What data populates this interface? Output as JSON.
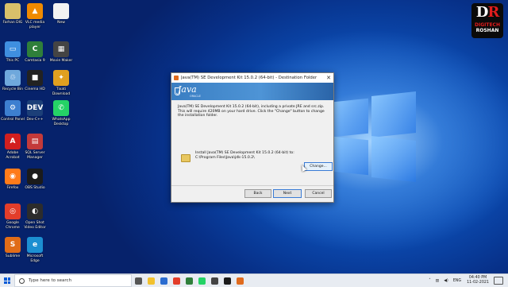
{
  "desktop_icons": [
    {
      "label": "Farhan DIG",
      "color": "#d8c06a",
      "glyph": "",
      "left": 0,
      "top": 0
    },
    {
      "label": "VLC media player",
      "color": "#f08a00",
      "glyph": "▲",
      "left": 0,
      "top": 0
    },
    {
      "label": "New",
      "color": "#f2f2f2",
      "glyph": "",
      "left": 0,
      "top": 0
    },
    {
      "label": "This PC",
      "color": "#3f8fe0",
      "glyph": "▭",
      "left": 0,
      "top": 0
    },
    {
      "label": "Camtasia 9",
      "color": "#2f7f3a",
      "glyph": "C",
      "left": 0,
      "top": 0
    },
    {
      "label": "Movie Maker",
      "color": "#444444",
      "glyph": "▦",
      "left": 0,
      "top": 0
    },
    {
      "label": "Recycle Bin",
      "color": "#6fa8dc",
      "glyph": "♲",
      "left": 0,
      "top": 0
    },
    {
      "label": "Cinema HD",
      "color": "#222222",
      "glyph": "■",
      "left": 0,
      "top": 0
    },
    {
      "label": "Tixati Download",
      "color": "#e0a020",
      "glyph": "✦",
      "left": 0,
      "top": 0
    },
    {
      "label": "Control Panel",
      "color": "#3d7fd0",
      "glyph": "⚙",
      "left": 0,
      "top": 0
    },
    {
      "label": "Dev-C++",
      "color": "#1c3f78",
      "glyph": "DEV",
      "left": 0,
      "top": 0
    },
    {
      "label": "WhatsApp Desktop",
      "color": "#25d366",
      "glyph": "✆",
      "left": 0,
      "top": 0
    },
    {
      "label": "Adobe Acrobat",
      "color": "#d21f1f",
      "glyph": "A",
      "left": 0,
      "top": 0
    },
    {
      "label": "SQL Server Manager",
      "color": "#c33a3a",
      "glyph": "▤",
      "left": 0,
      "top": 0
    },
    {
      "label": "Firefox",
      "color": "#ff7b1a",
      "glyph": "◉",
      "left": 0,
      "top": 0
    },
    {
      "label": "OBS Studio",
      "color": "#1b1b1b",
      "glyph": "●",
      "left": 0,
      "top": 0
    },
    {
      "label": "Google Chrome",
      "color": "#e33d2a",
      "glyph": "◎",
      "left": 0,
      "top": 0
    },
    {
      "label": "Open Shot Video Editor",
      "color": "#2c2c2c",
      "glyph": "◐",
      "left": 0,
      "top": 0
    },
    {
      "label": "Sublime",
      "color": "#e06c18",
      "glyph": "S",
      "left": 0,
      "top": 0
    },
    {
      "label": "Microsoft Edge",
      "color": "#1c8fd1",
      "glyph": "e",
      "left": 0,
      "top": 0
    }
  ],
  "watermark": {
    "dr_d": "D",
    "dr_r": "R",
    "line1": "DIGITECH",
    "line2": "ROSHAN"
  },
  "installer": {
    "title": "Java(TM) SE Development Kit 15.0.2 (64-bit) - Destination Folder",
    "close_glyph": "✕",
    "banner_logo": "Java",
    "banner_sub": "ORACLE",
    "description": "Java(TM) SE Development Kit 15.0.2 (64-bit), including a private JRE and src.zip. This will require 420MB on your hard drive. Click the \"Change\" button to change the installation folder.",
    "install_to_label": "Install Java(TM) SE Development Kit 15.0.2 (64-bit) to:",
    "install_path": "C:\\Program Files\\Java\\jdk-15.0.2\\",
    "change_label": "Change...",
    "back_label": "Back",
    "next_label": "Next",
    "cancel_label": "Cancel"
  },
  "taskbar": {
    "search_placeholder": "Type here to search",
    "apps": [
      {
        "name": "task-view-icon",
        "color": "#555555"
      },
      {
        "name": "file-explorer-icon",
        "color": "#f2c12e"
      },
      {
        "name": "store-icon",
        "color": "#2b6cd0"
      },
      {
        "name": "chrome-icon",
        "color": "#e33d2a"
      },
      {
        "name": "camtasia-icon",
        "color": "#2f7f3a"
      },
      {
        "name": "whatsapp-icon",
        "color": "#25d366"
      },
      {
        "name": "media-icon",
        "color": "#444444"
      },
      {
        "name": "obs-icon",
        "color": "#1b1b1b"
      },
      {
        "name": "java-icon",
        "color": "#e06b1e"
      }
    ],
    "tray_lang": "ENG",
    "time": "04:40 PM",
    "date": "11-02-2021"
  }
}
